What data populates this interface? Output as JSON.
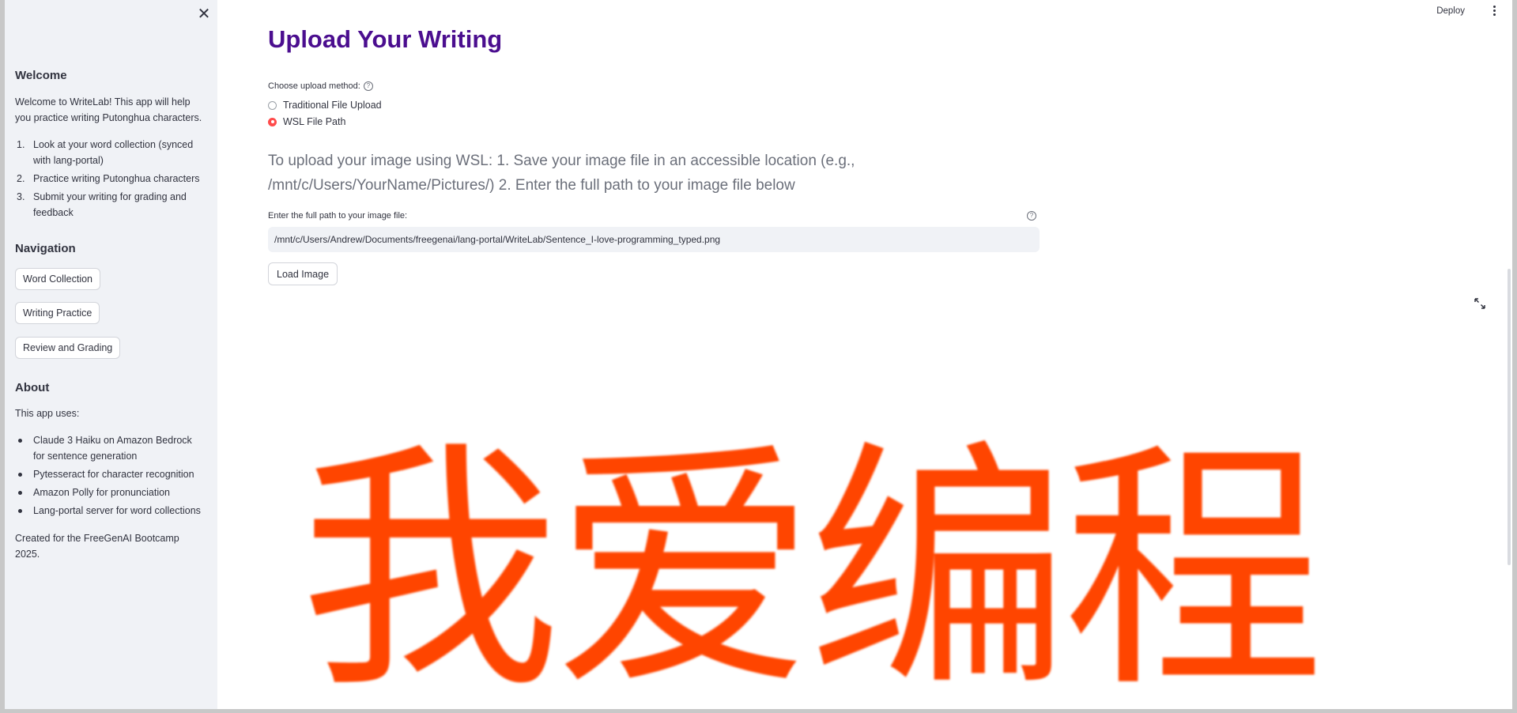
{
  "sidebar": {
    "close_icon": "close-icon",
    "welcome": {
      "heading": "Welcome",
      "intro": "Welcome to WriteLab! This app will help you practice writing Putonghua characters.",
      "steps": [
        "Look at your word collection (synced with lang-portal)",
        "Practice writing Putonghua characters",
        "Submit your writing for grading and feedback"
      ]
    },
    "navigation": {
      "heading": "Navigation",
      "buttons": [
        "Word Collection",
        "Writing Practice",
        "Review and Grading"
      ]
    },
    "about": {
      "heading": "About",
      "intro": "This app uses:",
      "items": [
        "Claude 3 Haiku on Amazon Bedrock for sentence generation",
        "Pytesseract for character recognition",
        "Amazon Polly for pronunciation",
        "Lang-portal server for word collections"
      ],
      "footer": "Created for the FreeGenAI Bootcamp 2025."
    }
  },
  "header": {
    "deploy_label": "Deploy",
    "menu_icon": "kebab-menu-icon"
  },
  "main": {
    "title": "Upload Your Writing",
    "upload_method": {
      "label": "Choose upload method:",
      "options": [
        "Traditional File Upload",
        "WSL File Path"
      ],
      "selected": "WSL File Path"
    },
    "instructions": "To upload your image using WSL: 1. Save your image file in an accessible location (e.g., /mnt/c/Users/YourName/Pictures/) 2. Enter the full path to your image file below",
    "path_field": {
      "label": "Enter the full path to your image file:",
      "value": "/mnt/c/Users/Andrew/Documents/freegenai/lang-portal/WriteLab/Sentence_I-love-programming_typed.png"
    },
    "load_button": "Load Image",
    "image": {
      "text": "我爱编程",
      "color": "#ff4500"
    }
  },
  "colors": {
    "title": "#4b0e8f",
    "accent": "#ff4b4b",
    "sidebar_bg": "#f0f2f6"
  }
}
